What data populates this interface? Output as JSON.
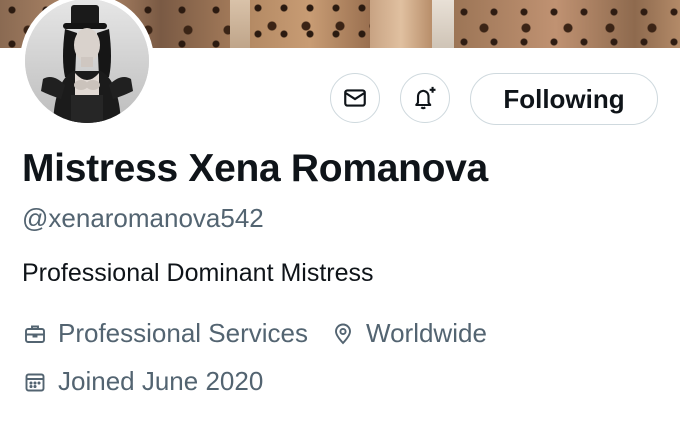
{
  "profile": {
    "display_name": "Mistress Xena Romanova",
    "handle": "@xenaromanova542",
    "bio": "Professional Dominant Mistress",
    "category": "Professional Services",
    "location": "Worldwide",
    "joined": "Joined June 2020"
  },
  "actions": {
    "following_label": "Following",
    "message_icon": "envelope-icon",
    "notify_icon": "bell-plus-icon"
  },
  "icons": {
    "category": "briefcase-icon",
    "location": "location-pin-icon",
    "joined": "calendar-icon"
  },
  "colors": {
    "text_primary": "#0f1419",
    "text_secondary": "#536471",
    "button_border": "#cfd9de",
    "background": "#ffffff"
  }
}
